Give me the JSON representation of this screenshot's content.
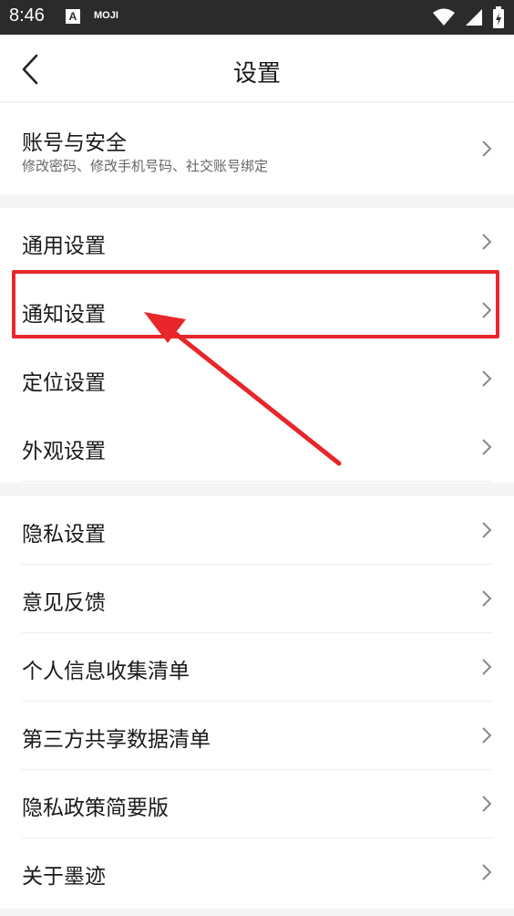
{
  "status_bar": {
    "time": "8:46",
    "app_badge": "A",
    "app_name": "MOJI"
  },
  "header": {
    "title": "设置"
  },
  "account": {
    "label": "账号与安全",
    "subtitle": "修改密码、修改手机号码、社交账号绑定"
  },
  "section_general": {
    "items": [
      {
        "label": "通用设置"
      },
      {
        "label": "通知设置"
      },
      {
        "label": "定位设置"
      },
      {
        "label": "外观设置"
      }
    ]
  },
  "section_privacy": {
    "items": [
      {
        "label": "隐私设置"
      },
      {
        "label": "意见反馈"
      },
      {
        "label": "个人信息收集清单"
      },
      {
        "label": "第三方共享数据清单"
      },
      {
        "label": "隐私政策简要版"
      },
      {
        "label": "关于墨迹"
      }
    ]
  },
  "colors": {
    "highlight": "#e8262b",
    "status_bar": "#2b2b2b",
    "background": "#f5f5f5"
  },
  "icons": {
    "back": "chevron-left-icon",
    "row_arrow": "chevron-right-icon",
    "wifi": "wifi-icon",
    "signal": "signal-icon",
    "battery": "battery-icon"
  }
}
